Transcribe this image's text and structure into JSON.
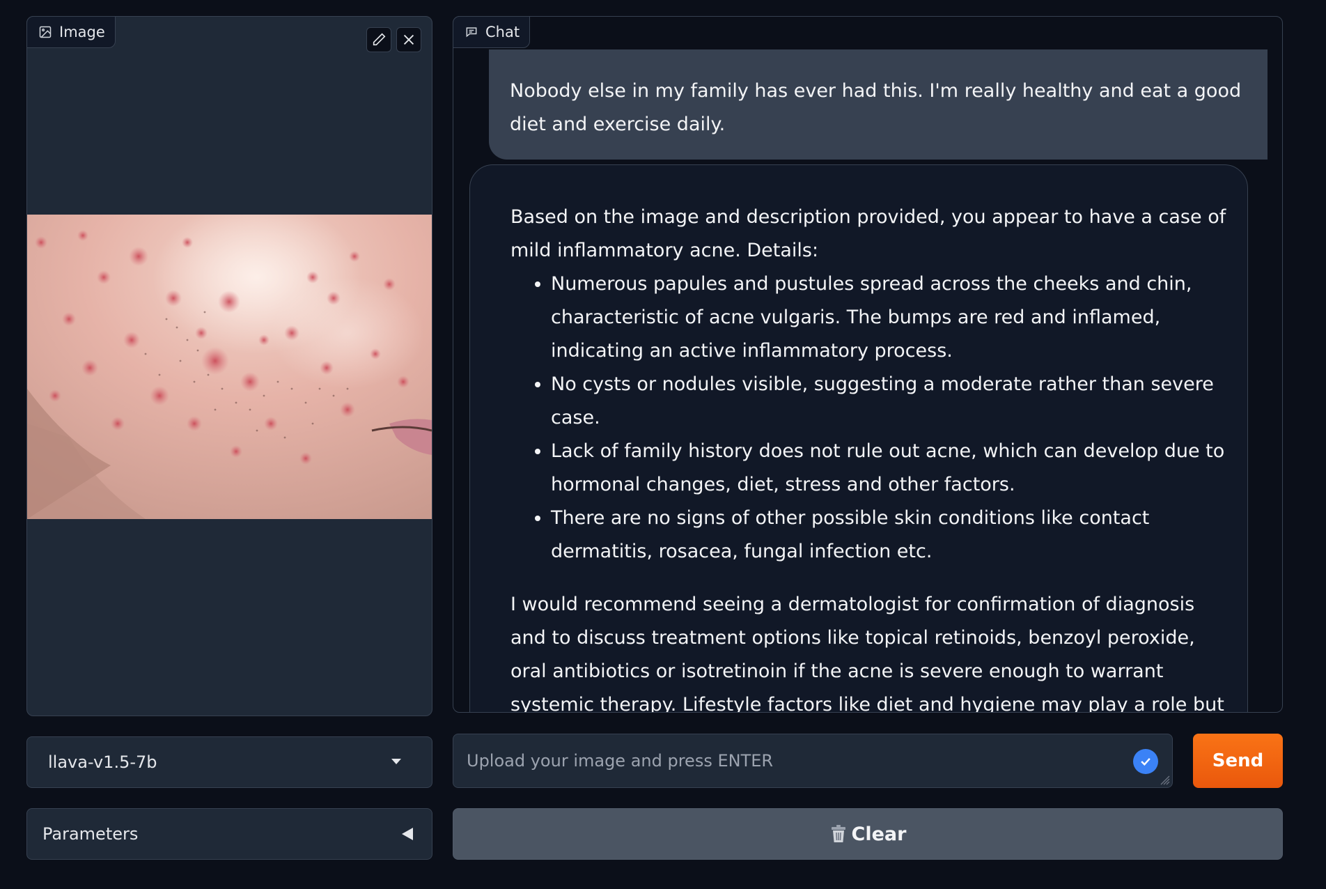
{
  "image_panel": {
    "tab_label": "Image",
    "edit_icon": "pencil-icon",
    "close_icon": "close-icon"
  },
  "chat_panel": {
    "tab_label": "Chat",
    "messages": [
      {
        "role": "user",
        "text": "Nobody else in my family has ever had this. I'm really healthy and eat a good diet and exercise daily."
      },
      {
        "role": "assistant",
        "intro": "Based on the image and description provided, you appear to have a case of mild inflammatory acne. Details:",
        "bullets": [
          "Numerous papules and pustules spread across the cheeks and chin, characteristic of acne vulgaris. The bumps are red and inflamed, indicating an active inflammatory process.",
          "No cysts or nodules visible, suggesting a moderate rather than severe case.",
          "Lack of family history does not rule out acne, which can develop due to hormonal changes, diet, stress and other factors.",
          "There are no signs of other possible skin conditions like contact dermatitis, rosacea, fungal infection etc."
        ],
        "recommendation": "I would recommend seeing a dermatologist for confirmation of diagnosis and to discuss treatment options like topical retinoids, benzoyl peroxide, oral antibiotics or isotretinoin if the acne is severe enough to warrant systemic therapy. Lifestyle factors like diet and hygiene may play a role but medical treatment is typically needed to control acne."
      }
    ]
  },
  "model_select": {
    "value": "llava-v1.5-7b"
  },
  "input": {
    "placeholder": "Upload your image and press ENTER"
  },
  "send_label": "Send",
  "parameters_label": "Parameters",
  "clear_label": "Clear",
  "clear_icon": "trash-icon",
  "colors": {
    "background": "#0b0f19",
    "panel": "#1f2937",
    "accent": "#f97316",
    "check": "#3b82f6"
  }
}
